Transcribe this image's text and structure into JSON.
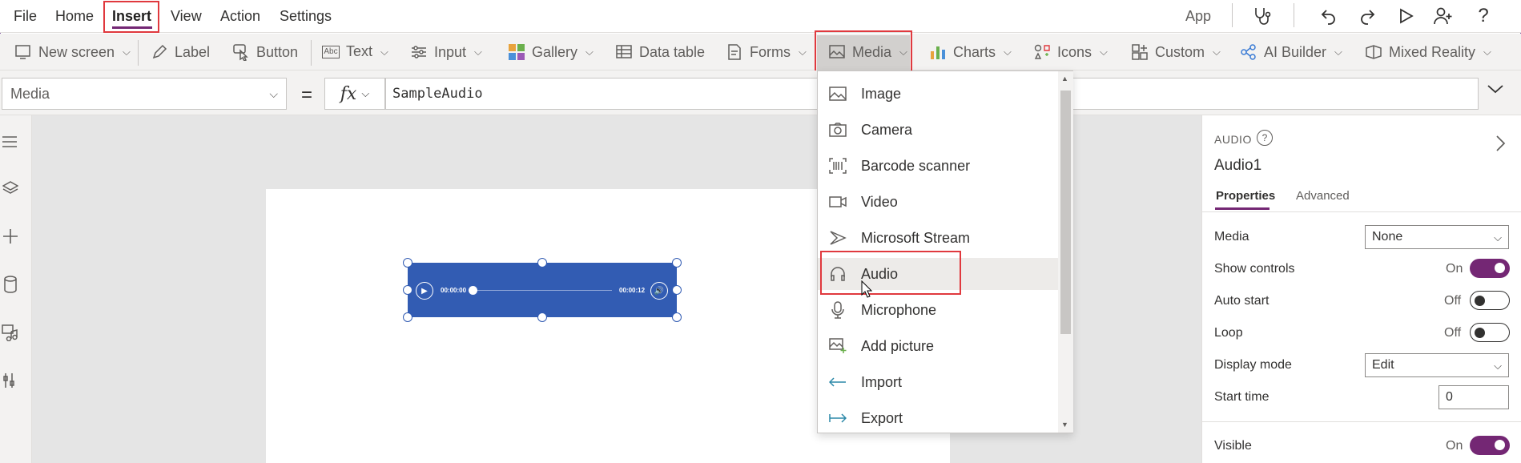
{
  "menu": {
    "items": [
      "File",
      "Home",
      "Insert",
      "View",
      "Action",
      "Settings"
    ],
    "app_label": "App"
  },
  "ribbon": {
    "new_screen": "New screen",
    "label": "Label",
    "button": "Button",
    "text": "Text",
    "input": "Input",
    "gallery": "Gallery",
    "data_table": "Data table",
    "forms": "Forms",
    "media": "Media",
    "charts": "Charts",
    "icons": "Icons",
    "custom": "Custom",
    "ai_builder": "AI Builder",
    "mixed_reality": "Mixed Reality"
  },
  "formula": {
    "property": "Media",
    "equals": "=",
    "fx": "fx",
    "value": "SampleAudio"
  },
  "audio_player": {
    "current_time": "00:00:00",
    "duration": "00:00:12"
  },
  "media_menu": {
    "items": [
      {
        "label": "Image",
        "icon": "image-icon"
      },
      {
        "label": "Camera",
        "icon": "camera-icon"
      },
      {
        "label": "Barcode scanner",
        "icon": "barcode-icon"
      },
      {
        "label": "Video",
        "icon": "video-icon"
      },
      {
        "label": "Microsoft Stream",
        "icon": "stream-icon"
      },
      {
        "label": "Audio",
        "icon": "headphones-icon"
      },
      {
        "label": "Microphone",
        "icon": "microphone-icon"
      },
      {
        "label": "Add picture",
        "icon": "add-picture-icon"
      },
      {
        "label": "Import",
        "icon": "import-icon"
      },
      {
        "label": "Export",
        "icon": "export-icon"
      }
    ]
  },
  "panel": {
    "type": "AUDIO",
    "help": "?",
    "name": "Audio1",
    "tabs": [
      "Properties",
      "Advanced"
    ],
    "media_label": "Media",
    "media_value": "None",
    "show_controls_label": "Show controls",
    "show_controls_state": "On",
    "auto_start_label": "Auto start",
    "auto_start_state": "Off",
    "loop_label": "Loop",
    "loop_state": "Off",
    "display_mode_label": "Display mode",
    "display_mode_value": "Edit",
    "start_time_label": "Start time",
    "start_time_value": "0",
    "visible_label": "Visible",
    "visible_state": "On"
  },
  "colors": {
    "accent": "#742774",
    "highlight": "#e0393e",
    "audio_control": "#325cb3"
  }
}
